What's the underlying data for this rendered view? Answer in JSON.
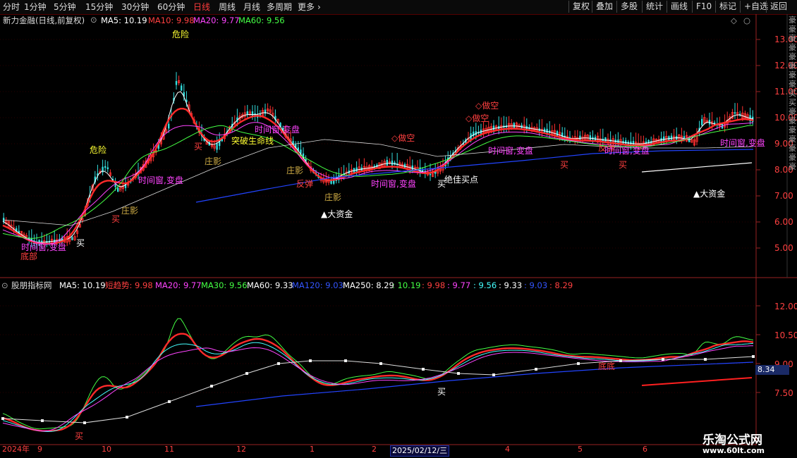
{
  "toolbar": {
    "periods": [
      "分时",
      "1分钟",
      "5分钟",
      "15分钟",
      "30分钟",
      "60分钟",
      "日线",
      "周线",
      "月线",
      "多周期",
      "更多"
    ],
    "active_period": "日线",
    "right_buttons": [
      "复权",
      "叠加",
      "多股",
      "统计",
      "画线",
      "F10",
      "标记",
      "+自选",
      "返回"
    ]
  },
  "main_panel": {
    "title": "新力金融(日线,前复权)",
    "ma_items": [
      {
        "label": "MA5: 10.19",
        "color": "#ffffff"
      },
      {
        "label": "MA10: 9.98",
        "color": "#ff4040"
      },
      {
        "label": "MA20: 9.77",
        "color": "#ff44ff"
      },
      {
        "label": "MA60: 9.56",
        "color": "#44ff44"
      }
    ],
    "price_ticks": [
      "13.00",
      "12.00",
      "11.00",
      "10.00",
      "9.00",
      "8.00",
      "7.00",
      "6.00",
      "5.00"
    ],
    "side_text": "豪豪豪豪豪豪豪豪买买豪豪豪豪豪豪豪"
  },
  "signals": [
    {
      "text": "危险",
      "color": "#ffff33"
    },
    {
      "text": "危险",
      "color": "#ffff33"
    },
    {
      "text": "底部",
      "color": "#ff4040"
    },
    {
      "text": "时间窗,变盘",
      "color": "#ff44ff"
    },
    {
      "text": "买",
      "color": "#ffffff"
    },
    {
      "text": "买",
      "color": "#ff4040"
    },
    {
      "text": "庄影",
      "color": "#ccaa44"
    },
    {
      "text": "时间窗,变盘",
      "color": "#ff44ff"
    },
    {
      "text": "买",
      "color": "#ff4040"
    },
    {
      "text": "庄影",
      "color": "#ccaa44"
    },
    {
      "text": "突破生命线",
      "color": "#ffff33"
    },
    {
      "text": "时间窗,变盘",
      "color": "#ff44ff"
    },
    {
      "text": "庄影",
      "color": "#ccaa44"
    },
    {
      "text": "反弹",
      "color": "#ff4040"
    },
    {
      "text": "庄影",
      "color": "#ccaa44"
    },
    {
      "text": "▲大资金",
      "color": "#ffffff"
    },
    {
      "text": "时间窗,变盘",
      "color": "#ff44ff"
    },
    {
      "text": "◇做空",
      "color": "#ff4040"
    },
    {
      "text": "买",
      "color": "#ffffff"
    },
    {
      "text": "绝佳买点",
      "color": "#ffffff"
    },
    {
      "text": "◇做空",
      "color": "#ff4040"
    },
    {
      "text": "◇做空",
      "color": "#ff4040"
    },
    {
      "text": "时间窗,变盘",
      "color": "#ff44ff"
    },
    {
      "text": "买",
      "color": "#ff4040"
    },
    {
      "text": "反弹",
      "color": "#ff4040"
    },
    {
      "text": "时间窗,变盘",
      "color": "#ff44ff"
    },
    {
      "text": "买",
      "color": "#ff4040"
    },
    {
      "text": "▲大资金",
      "color": "#ffffff"
    },
    {
      "text": "时间窗,变盘",
      "color": "#ff44ff"
    }
  ],
  "indicator_panel": {
    "title": "股朋指标网",
    "items": [
      {
        "label": "MA5: 10.19",
        "color": "#ffffff"
      },
      {
        "label": "短趋势: 9.98",
        "color": "#ff4040"
      },
      {
        "label": "MA20: 9.77",
        "color": "#ff44ff"
      },
      {
        "label": "MA30: 9.56",
        "color": "#44ff44"
      },
      {
        "label": "MA60: 9.33",
        "color": "#ffffff"
      },
      {
        "label": "MA120: 9.03",
        "color": "#3355ff"
      },
      {
        "label": "MA250: 8.29",
        "color": "#ffffff"
      },
      {
        "label": ": 10.19",
        "color": "#44ff44"
      },
      {
        "label": ": 9.98",
        "color": "#ff4040"
      },
      {
        "label": ": 9.77",
        "color": "#ff44ff"
      },
      {
        "label": ": 9.56",
        "color": "#44ffff"
      },
      {
        "label": ": 9.33",
        "color": "#ffffff"
      },
      {
        "label": ": 9.03",
        "color": "#3355ff"
      },
      {
        "label": ": 8.29",
        "color": "#ff4040"
      }
    ],
    "ticks": [
      "12.00",
      "10.50",
      "9.00",
      "7.50"
    ],
    "current_value": "8.34",
    "signals": [
      {
        "text": "买",
        "color": "#ff4040"
      },
      {
        "text": "买",
        "color": "#ffffff"
      },
      {
        "text": "底底",
        "color": "#ff4040"
      }
    ]
  },
  "date_axis": {
    "labels": [
      "2024年",
      "9",
      "10",
      "11",
      "12",
      "1",
      "2",
      "4",
      "5",
      "6"
    ],
    "cursor_date": "2025/02/12/三"
  },
  "watermark": {
    "line1": "乐淘公式网",
    "line2": "www.60lt.com"
  }
}
